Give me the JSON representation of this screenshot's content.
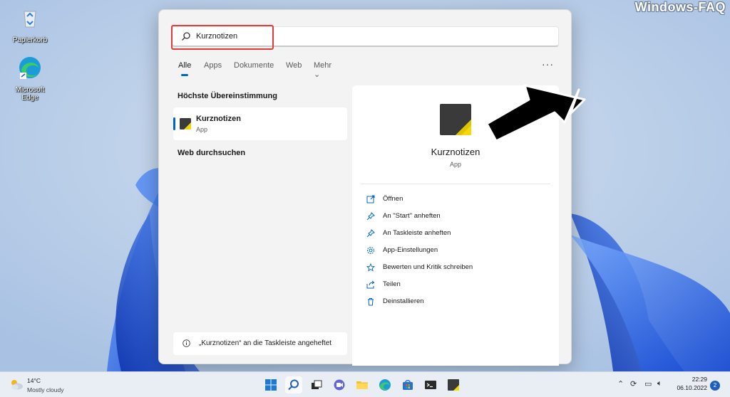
{
  "watermark": "Windows-FAQ",
  "desktop": {
    "icons": [
      {
        "label": "Papierkorb",
        "icon": "recycle-bin-icon"
      },
      {
        "label": "Microsoft Edge",
        "icon": "edge-icon"
      }
    ]
  },
  "search": {
    "value": "Kurznotizen",
    "icon": "search-icon"
  },
  "tabs": [
    {
      "label": "Alle",
      "active": true
    },
    {
      "label": "Apps"
    },
    {
      "label": "Dokumente"
    },
    {
      "label": "Web"
    },
    {
      "label": "Mehr ⌄"
    }
  ],
  "more_menu": "···",
  "left": {
    "best_match_title": "Höchste Übereinstimmung",
    "best_match": {
      "name": "Kurznotizen",
      "type": "App",
      "icon": "sticky-notes-icon"
    },
    "web_title": "Web durchsuchen",
    "notification": "„Kurznotizen“ an die Taskleiste angeheftet"
  },
  "detail": {
    "name": "Kurznotizen",
    "type": "App",
    "actions": [
      {
        "label": "Öffnen",
        "icon": "open-icon"
      },
      {
        "label": "An \"Start\" anheften",
        "icon": "pin-icon"
      },
      {
        "label": "An Taskleiste anheften",
        "icon": "pin-icon"
      },
      {
        "label": "App-Einstellungen",
        "icon": "gear-icon"
      },
      {
        "label": "Bewerten und Kritik schreiben",
        "icon": "star-icon"
      },
      {
        "label": "Teilen",
        "icon": "share-icon"
      },
      {
        "label": "Deinstallieren",
        "icon": "trash-icon"
      }
    ]
  },
  "taskbar": {
    "weather": {
      "temp": "14°C",
      "desc": "Mostly cloudy"
    },
    "apps": [
      "start-icon",
      "search-icon",
      "task-view-icon",
      "chat-icon",
      "file-explorer-icon",
      "edge-icon",
      "store-icon",
      "terminal-icon",
      "sticky-notes-icon"
    ],
    "time": "22:29",
    "date": "06.10.2022",
    "notifications": "2"
  },
  "colors": {
    "accent": "#0067c0",
    "highlight_box": "#e23b3b",
    "sticky_yellow": "#f5d90a",
    "sticky_dark": "#3a3a3a"
  }
}
